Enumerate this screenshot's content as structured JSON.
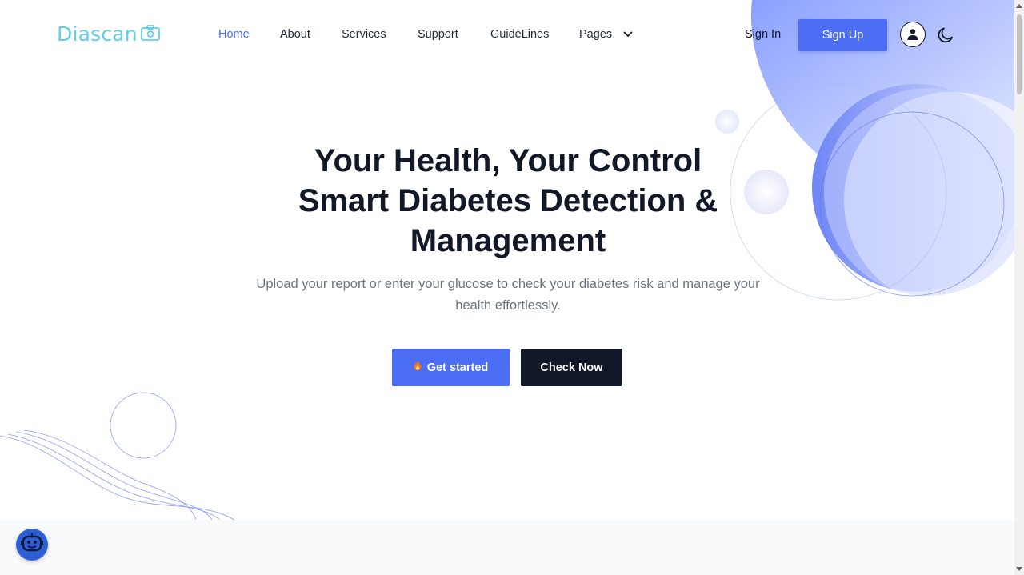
{
  "brand": {
    "name": "Diascan",
    "icon": "camera-icon",
    "color": "#62cfe8"
  },
  "nav": {
    "items": [
      {
        "label": "Home",
        "active": true
      },
      {
        "label": "About"
      },
      {
        "label": "Services"
      },
      {
        "label": "Support"
      },
      {
        "label": "GuideLines"
      },
      {
        "label": "Pages",
        "icon": "chevron-down-icon"
      }
    ]
  },
  "auth": {
    "sign_in": "Sign In",
    "sign_up": "Sign Up",
    "user_icon": "user-icon",
    "theme_icon": "moon-icon"
  },
  "hero": {
    "title_lines": [
      "Your Health, Your Control",
      "Smart Diabetes Detection &",
      "Management"
    ],
    "subtitle": "Upload your report or enter your glucose to check your diabetes risk and manage your health effortlessly.",
    "primary_button": "Get started",
    "primary_icon": "flame-icon",
    "secondary_button": "Check Now"
  },
  "chatbot": {
    "icon": "robot-icon"
  },
  "colors": {
    "accent": "#4c6ef5",
    "dark": "#111827",
    "muted": "#6b7280"
  }
}
